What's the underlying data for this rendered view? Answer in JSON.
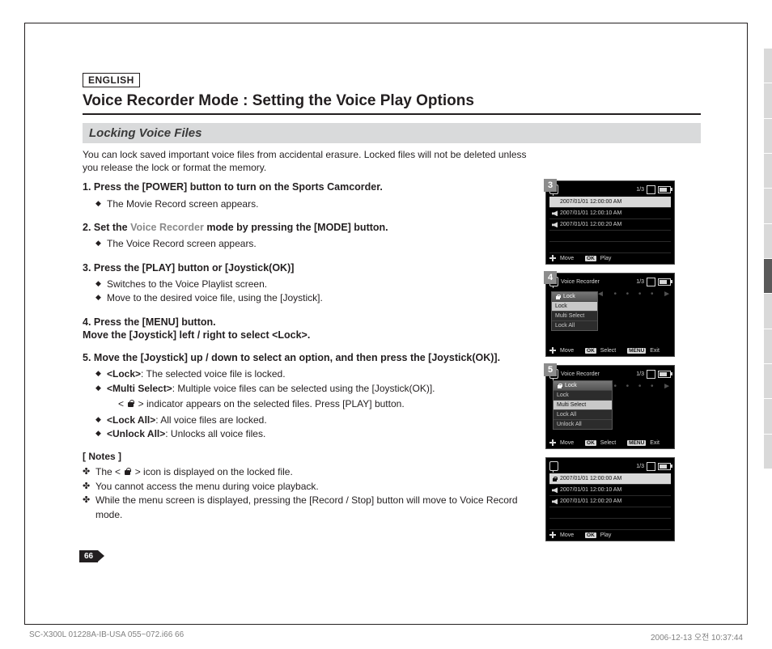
{
  "lang_label": "ENGLISH",
  "title": "Voice Recorder Mode : Setting the Voice Play Options",
  "subtitle": "Locking Voice Files",
  "intro": "You can lock saved important voice files from accidental erasure. Locked files will not be deleted unless you release the lock or format the memory.",
  "steps": [
    {
      "n": "1.",
      "text_a": "Press the [POWER] button to turn on the Sports Camcorder.",
      "sub": [
        "The Movie Record screen appears."
      ]
    },
    {
      "n": "2.",
      "text_a": "Set the ",
      "muted": "Voice Recorder",
      "text_b": " mode by pressing the [MODE] button.",
      "sub": [
        "The Voice Record screen appears."
      ]
    },
    {
      "n": "3.",
      "text_a": "Press the [PLAY] button or [Joystick(OK)]",
      "sub": [
        "Switches to the Voice Playlist screen.",
        "Move to the desired voice file, using the [Joystick]."
      ]
    },
    {
      "n": "4.",
      "text_a": "Press the [MENU] button.",
      "text_c": "Move the [Joystick] left / right to select <Lock>.",
      "sub": []
    },
    {
      "n": "5.",
      "text_a": "Move the [Joystick] up / down to select an option, and then press the [Joystick(OK)].",
      "sub": [
        {
          "bold": "<Lock>",
          "rest": ": The selected voice file is locked."
        },
        {
          "bold": "<Multi Select>",
          "rest": ": Multiple voice files can be selected using the [Joystick(OK)]."
        },
        {
          "indent": true,
          "pre": "< ",
          "icon": "lock",
          "post": " > indicator appears on the selected files. Press [PLAY] button."
        },
        {
          "bold": "<Lock All>",
          "rest": ": All voice files are locked."
        },
        {
          "bold": "<Unlock All>",
          "rest": ": Unlocks all voice files."
        }
      ]
    }
  ],
  "notes_header": "[ Notes ]",
  "notes": [
    {
      "pre": "The < ",
      "icon": "lock",
      "post": " > icon is displayed on the locked file."
    },
    {
      "text": "You cannot access the menu during voice playback."
    },
    {
      "text": "While the menu screen is displayed, pressing the [Record / Stop] button will move to Voice Record mode."
    }
  ],
  "page_no": "66",
  "footer_left": "SC-X300L 01228A-IB-USA 055~072.i66   66",
  "footer_right": "2006-12-13   오전 10:37:44",
  "screens": {
    "vr_label": "Voice Recorder",
    "counter": "1/3",
    "date1": "2007/01/01 12:00:00 AM",
    "date2": "2007/01/01 12:00:10 AM",
    "date3": "2007/01/01 12:00:20 AM",
    "move": "Move",
    "play": "Play",
    "select": "Select",
    "exit": "Exit",
    "ok": "OK",
    "menu_key": "MENU",
    "menu_lock": "Lock",
    "mi_lock": "Lock",
    "mi_multi": "Multi Select",
    "mi_lockall": "Lock All",
    "mi_unlockall": "Unlock All",
    "num3": "3",
    "num4": "4",
    "num5": "5"
  }
}
